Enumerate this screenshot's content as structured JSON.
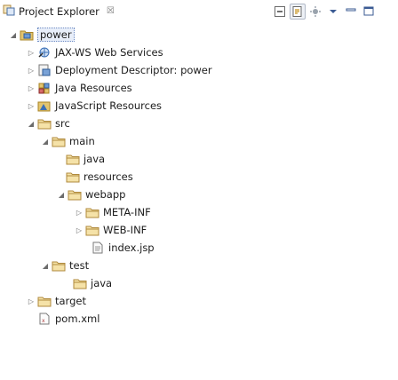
{
  "view": {
    "title": "Project Explorer",
    "close_glyph": "☒"
  },
  "toolbar": {
    "buttons": [
      {
        "name": "collapse-all-button",
        "icon": "collapse-all-icon"
      },
      {
        "name": "link-with-editor-button",
        "icon": "link-with-editor-icon",
        "active": true
      },
      {
        "name": "focus-button",
        "icon": "focus-icon"
      },
      {
        "name": "view-menu-button",
        "icon": "view-menu-icon"
      },
      {
        "name": "minimize-button",
        "icon": "minimize-icon"
      },
      {
        "name": "maximize-button",
        "icon": "maximize-icon"
      }
    ]
  },
  "tree": [
    {
      "label": "power",
      "icon": "project-icon",
      "expander": "expanded",
      "selected": true
    },
    {
      "label": "JAX-WS Web Services",
      "icon": "web-services-icon",
      "expander": "collapsed"
    },
    {
      "label": "Deployment Descriptor: power",
      "icon": "deployment-descriptor-icon",
      "expander": "collapsed"
    },
    {
      "label": "Java Resources",
      "icon": "java-resources-icon",
      "expander": "collapsed"
    },
    {
      "label": "JavaScript Resources",
      "icon": "javascript-resources-icon",
      "expander": "collapsed"
    },
    {
      "label": "src",
      "icon": "folder-icon",
      "expander": "expanded"
    },
    {
      "label": "main",
      "icon": "folder-icon",
      "expander": "expanded"
    },
    {
      "label": "java",
      "icon": "folder-icon",
      "expander": "none"
    },
    {
      "label": "resources",
      "icon": "folder-icon",
      "expander": "none"
    },
    {
      "label": "webapp",
      "icon": "folder-icon",
      "expander": "expanded"
    },
    {
      "label": "META-INF",
      "icon": "folder-icon",
      "expander": "collapsed"
    },
    {
      "label": "WEB-INF",
      "icon": "folder-icon",
      "expander": "collapsed"
    },
    {
      "label": "index.jsp",
      "icon": "file-icon",
      "expander": "none"
    },
    {
      "label": "test",
      "icon": "folder-icon",
      "expander": "expanded"
    },
    {
      "label": "java",
      "icon": "folder-icon",
      "expander": "none"
    },
    {
      "label": "target",
      "icon": "folder-icon",
      "expander": "collapsed"
    },
    {
      "label": "pom.xml",
      "icon": "xml-file-icon",
      "expander": "none"
    }
  ],
  "colors": {
    "folder": "#d8a64a",
    "selection": "#e8eef9",
    "accent": "#3b6fb6"
  }
}
